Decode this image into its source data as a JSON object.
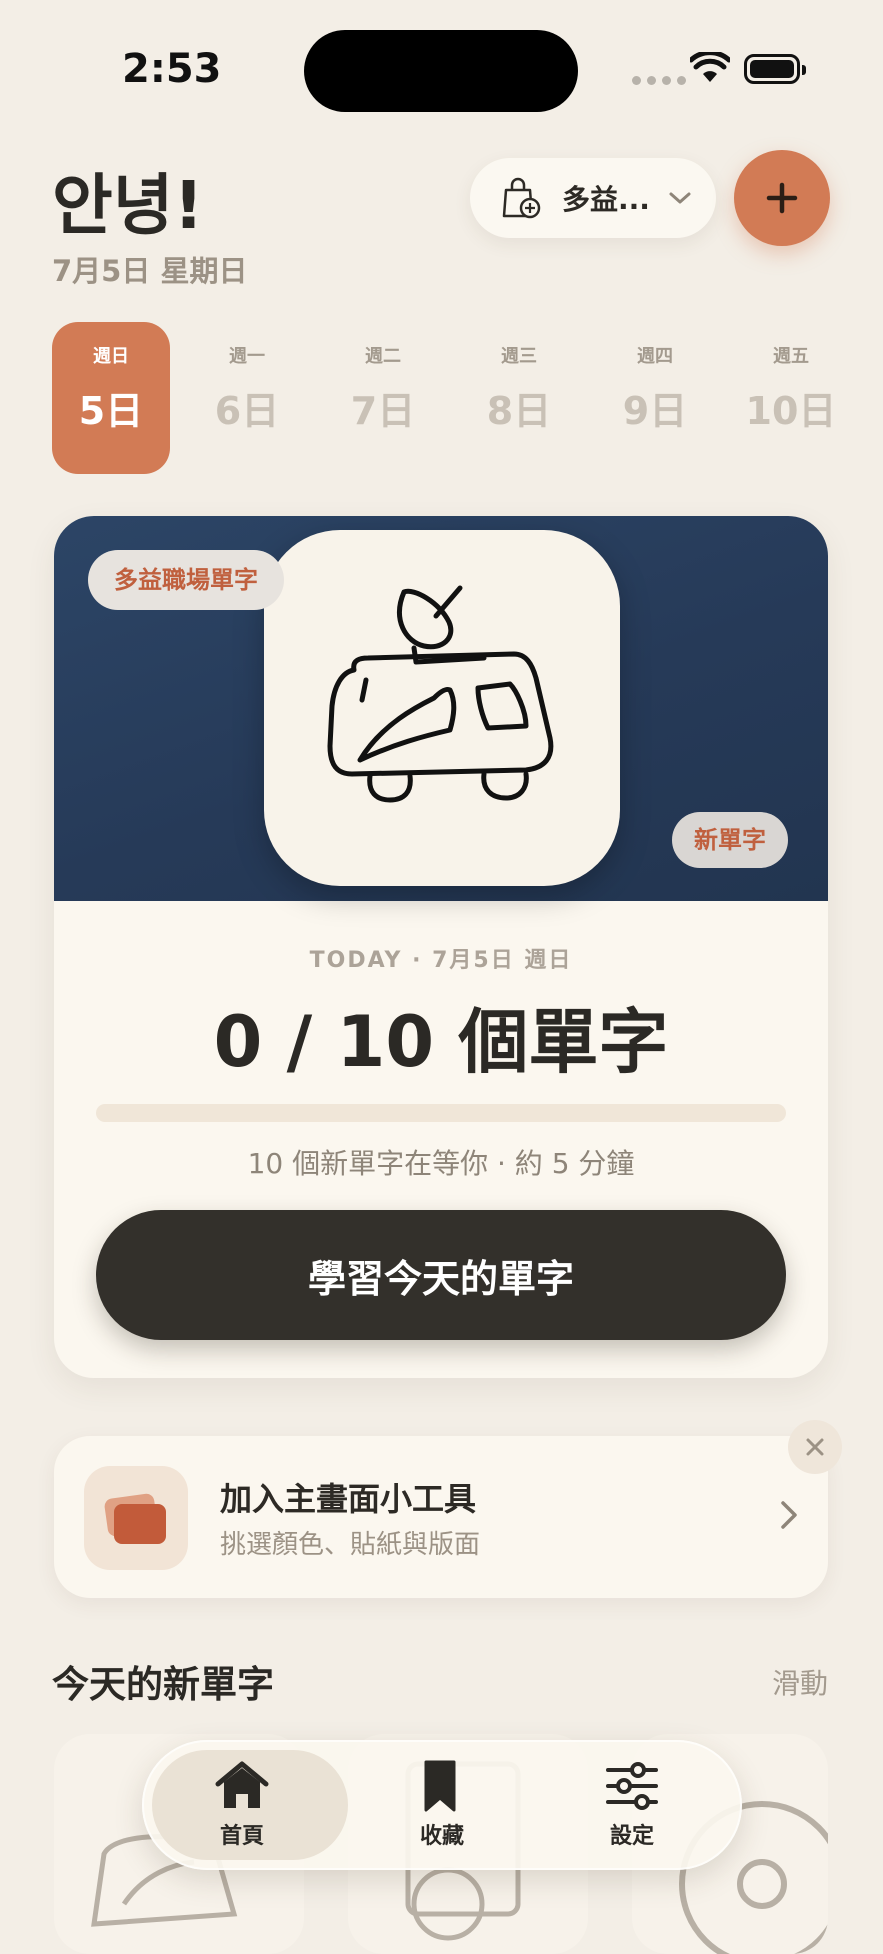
{
  "status_bar": {
    "time": "2:53"
  },
  "header": {
    "greeting": "안녕!",
    "date": "7月5日 星期日",
    "book_selector": "多益...",
    "add_button": "+"
  },
  "days": [
    {
      "weekday": "週日",
      "day": "5日",
      "selected": true
    },
    {
      "weekday": "週一",
      "day": "6日",
      "selected": false
    },
    {
      "weekday": "週二",
      "day": "7日",
      "selected": false
    },
    {
      "weekday": "週三",
      "day": "8日",
      "selected": false
    },
    {
      "weekday": "週四",
      "day": "9日",
      "selected": false
    },
    {
      "weekday": "週五",
      "day": "10日",
      "selected": false
    }
  ],
  "today_card": {
    "book_tag": "多益職場單字",
    "new_tag": "新單字",
    "today_label": "TODAY · 7月5日 週日",
    "count_text": "0 / 10 個單字",
    "progress": 0,
    "hint": "10 個新單字在等你 · 約 5 分鐘",
    "study_button": "學習今天的單字"
  },
  "widget_promo": {
    "title": "加入主畫面小工具",
    "subtitle": "挑選顏色、貼紙與版面"
  },
  "new_words_section": {
    "title": "今天的新單字",
    "action": "滑動"
  },
  "tab_bar": [
    {
      "label": "首頁",
      "icon": "house-icon",
      "active": true
    },
    {
      "label": "收藏",
      "icon": "bookmark-icon",
      "active": false
    },
    {
      "label": "設定",
      "icon": "sliders-icon",
      "active": false
    }
  ],
  "colors": {
    "accent": "#D27B55",
    "background": "#F3EEE6",
    "card": "#FBF7EF",
    "hero": "#263A58",
    "button_dark": "#33302B"
  }
}
